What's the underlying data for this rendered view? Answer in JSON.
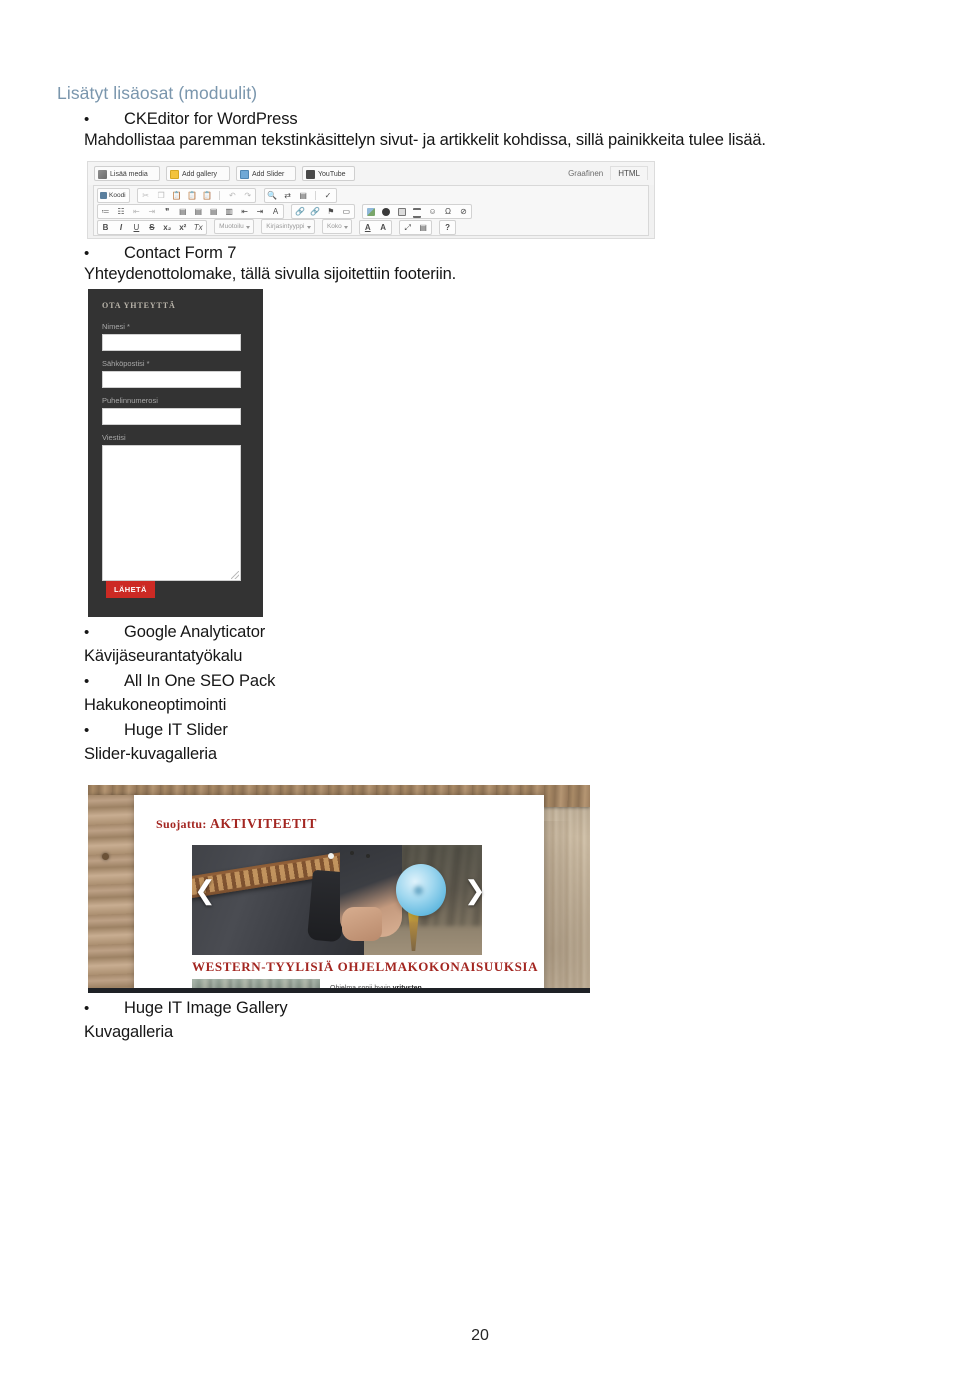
{
  "document": {
    "heading": "Lisätyt lisäosat (moduulit)",
    "page_number": "20",
    "bullet_glyph": "•",
    "items": [
      {
        "bullet": "CKEditor for WordPress",
        "description": "Mahdollistaa paremman tekstinkäsittelyn sivut- ja artikkelit kohdissa, sillä painikkeita tulee lisää."
      },
      {
        "bullet": "Contact Form 7",
        "description": "Yhteydenottolomake, tällä sivulla sijoitettiin footeriin."
      },
      {
        "bullet": "Google Analyticator",
        "description": "Kävijäseurantatyökalu"
      },
      {
        "bullet": "All In One SEO Pack",
        "description": "Hakukoneoptimointi"
      },
      {
        "bullet": "Huge IT Slider",
        "description": "Slider-kuvagalleria"
      },
      {
        "bullet": "Huge IT Image Gallery",
        "description": "Kuvagalleria"
      }
    ]
  },
  "ckeditor_screenshot": {
    "media_buttons": [
      {
        "label": "Lisää media",
        "icon": "media-icon"
      },
      {
        "label": "Add gallery",
        "icon": "gallery-icon"
      },
      {
        "label": "Add Slider",
        "icon": "slider-icon"
      },
      {
        "label": "YouTube",
        "icon": "youtube-icon"
      }
    ],
    "editor_tabs": [
      {
        "label": "Graafinen",
        "active": false
      },
      {
        "label": "HTML",
        "active": true
      }
    ],
    "toolbar_row1": {
      "source_button": "Koodi",
      "icons": [
        "cut-icon",
        "copy-icon",
        "paste-icon",
        "paste-text-icon",
        "paste-word-icon",
        "undo-icon",
        "redo-icon",
        "find-icon",
        "replace-icon",
        "select-all-icon",
        "spellcheck-icon"
      ]
    },
    "toolbar_row2": {
      "icons": [
        "numbered-list-icon",
        "bulleted-list-icon",
        "outdent-icon",
        "indent-icon",
        "blockquote-icon",
        "align-left-icon",
        "align-center-icon",
        "align-right-icon",
        "justify-icon",
        "ltr-icon",
        "rtl-icon",
        "language-icon",
        "link-icon",
        "unlink-icon",
        "anchor-icon",
        "unknown-icon",
        "image-icon",
        "flash-icon",
        "table-icon",
        "horizontal-rule-icon",
        "smiley-icon",
        "special-char-icon",
        "page-break-icon"
      ]
    },
    "toolbar_row3": {
      "icons": [
        "bold-icon",
        "italic-icon",
        "underline-icon",
        "strikethrough-icon",
        "subscript-icon",
        "superscript-icon",
        "remove-format-icon",
        "text-color-icon",
        "background-color-icon",
        "maximize-icon",
        "show-blocks-icon",
        "about-icon"
      ],
      "dropdowns": [
        "Muotoilu",
        "Kirjasintyyppi",
        "Koko"
      ],
      "glyphs": {
        "bold": "B",
        "italic": "I",
        "underline": "U",
        "strike": "S",
        "sub": "x₂",
        "sup": "x²",
        "removeformat": "Tx",
        "textcolor": "A",
        "bgcolor": "A",
        "maximize": "⤢",
        "showblocks": "▤",
        "about": "?"
      }
    }
  },
  "contact_form": {
    "title": "OTA YHTEYTTÄ",
    "fields": [
      {
        "label": "Nimesi *",
        "type": "text",
        "value": ""
      },
      {
        "label": "Sähköpostisi *",
        "type": "email",
        "value": ""
      },
      {
        "label": "Puhelinnumerosi",
        "type": "tel",
        "value": ""
      },
      {
        "label": "Viestisi",
        "type": "textarea",
        "value": ""
      }
    ],
    "submit_label": "LÄHETÄ",
    "colors": {
      "background": "#333333",
      "submit": "#cc2a24",
      "label": "#a8a8a8"
    }
  },
  "slider_screenshot": {
    "category_prefix": "Suojattu:",
    "category_name": "AKTIVITEETIT",
    "post_title": "WESTERN-TYYLISIÄ OHJELMAKOKONAISUUKSIA",
    "excerpt_plain": "Ohjelma sopii hyvin ",
    "excerpt_bold": "yritysten",
    "prev_arrow": "❮",
    "next_arrow": "❯",
    "colors": {
      "accent_red": "#a32621",
      "panel": "#ffffff",
      "wood": "#ab8f70"
    }
  }
}
